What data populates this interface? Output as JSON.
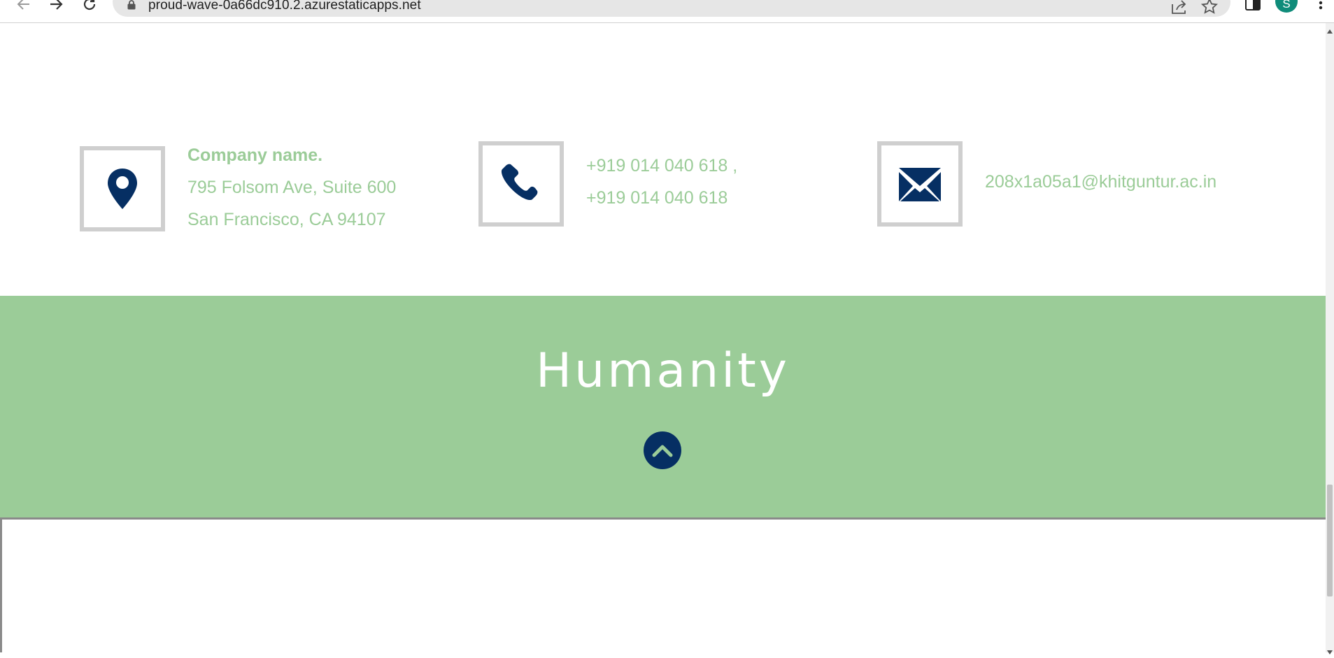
{
  "browser": {
    "url": "proud-wave-0a66dc910.2.azurestaticapps.net",
    "profile_initial": "S",
    "back_icon": "arrow-left-icon",
    "forward_icon": "arrow-right-icon",
    "reload_icon": "reload-icon",
    "lock_icon": "lock-icon",
    "share_icon": "share-icon",
    "bookmark_icon": "star-icon",
    "sidebar_icon": "side-panel-icon",
    "menu_icon": "kebab-menu-icon"
  },
  "contact": {
    "address": {
      "icon": "map-pin-icon",
      "company": "Company name.",
      "street": "795 Folsom Ave, Suite 600",
      "city": "San Francisco, CA 94107"
    },
    "phone": {
      "icon": "phone-icon",
      "line1": "+919 014 040 618 ,",
      "line2": "+919 014 040 618"
    },
    "email": {
      "icon": "envelope-icon",
      "address": "208x1a05a1@khitguntur.ac.in"
    }
  },
  "footer": {
    "brand": "Humanity",
    "back_to_top_icon": "chevron-up-icon"
  },
  "colors": {
    "accent_green": "#9bcc98",
    "navy": "#062f63",
    "icon_border": "#cfcfcf"
  }
}
